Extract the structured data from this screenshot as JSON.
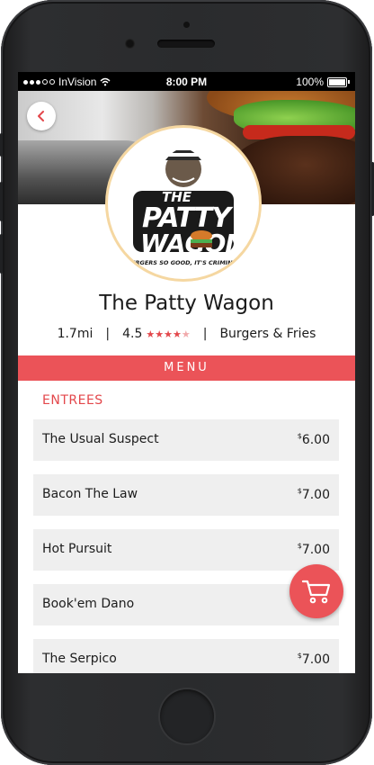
{
  "status_bar": {
    "carrier": "InVision",
    "time": "8:00 PM",
    "battery": "100%"
  },
  "logo": {
    "line1": "THE",
    "line2": "PATTY",
    "line3": "WAGON",
    "tagline": "BURGERS SO GOOD, IT'S CRIMINAL"
  },
  "restaurant": {
    "name": "The Patty Wagon",
    "distance": "1.7mi",
    "rating": "4.5",
    "rating_value": 4.5,
    "category": "Burgers & Fries",
    "separator": "|"
  },
  "menu": {
    "header": "MENU",
    "section_title": "ENTREES",
    "currency_symbol": "$",
    "items": [
      {
        "name": "The Usual Suspect",
        "price": "6.00"
      },
      {
        "name": "Bacon The Law",
        "price": "7.00"
      },
      {
        "name": "Hot Pursuit",
        "price": "7.00"
      },
      {
        "name": "Book'em Dano",
        "price": ""
      },
      {
        "name": "The Serpico",
        "price": "7.00"
      }
    ]
  },
  "icons": {
    "back": "chevron-left-icon",
    "cart": "shopping-cart-icon",
    "wifi": "wifi-icon",
    "star": "star-icon"
  },
  "colors": {
    "accent": "#eb5358",
    "star": "#e3474b",
    "item_background": "#efefef",
    "logo_ring": "#f5d7a1"
  }
}
